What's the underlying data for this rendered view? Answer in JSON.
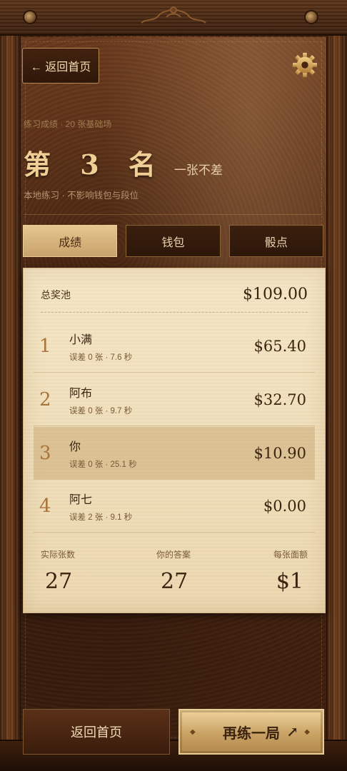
{
  "header": {
    "back_label": "← 返回首页"
  },
  "summary": {
    "subtitle": "练习成绩 · 20 张基础场",
    "rank": "第 3 名",
    "rank_note": "一张不差",
    "hint": "本地练习 · 不影响钱包与段位"
  },
  "tabs": [
    {
      "label": "成绩",
      "active": true
    },
    {
      "label": "钱包",
      "active": false
    },
    {
      "label": "骰点",
      "active": false
    }
  ],
  "card": {
    "pool_label": "总奖池",
    "pool_value": "$109.00",
    "rows": [
      {
        "num": "1",
        "name": "小满",
        "meta": "误差 0 张 · 7.6 秒",
        "amount": "$65.40",
        "me": false
      },
      {
        "num": "2",
        "name": "阿布",
        "meta": "误差 0 张 · 9.7 秒",
        "amount": "$32.70",
        "me": false
      },
      {
        "num": "3",
        "name": "你",
        "meta": "误差 0 张 · 25.1 秒",
        "amount": "$10.90",
        "me": true
      },
      {
        "num": "4",
        "name": "阿七",
        "meta": "误差 2 张 · 9.1 秒",
        "amount": "$0.00",
        "me": false
      }
    ],
    "stats": [
      {
        "label": "实际张数",
        "value": "27"
      },
      {
        "label": "你的答案",
        "value": "27"
      },
      {
        "label": "每张面额",
        "value": "$1"
      }
    ]
  },
  "footer": {
    "home_label": "返回首页",
    "again_label": "再练一局",
    "again_arrow": "↗"
  },
  "icons": {
    "settings": "gear-icon",
    "back": "arrow-left-icon"
  },
  "colors": {
    "gold": "#e6c690",
    "leather": "#4a2510",
    "paper": "#f5e6c6"
  }
}
